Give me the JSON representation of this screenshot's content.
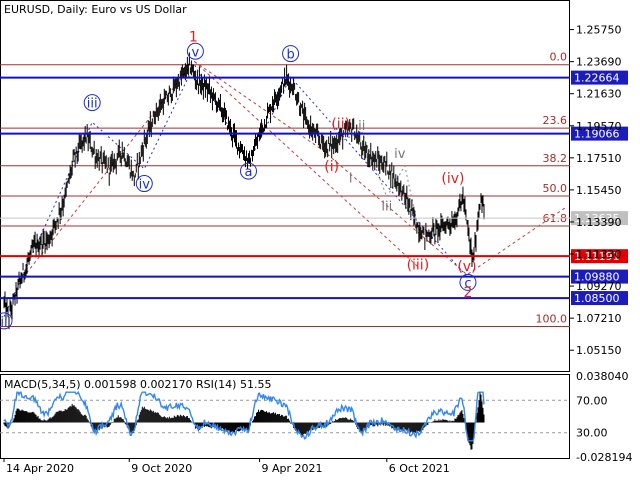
{
  "chart_data": {
    "type": "line",
    "title": "EURUSD, Daily:  Euro vs US Dollar",
    "price_axis": {
      "min": 1.0375,
      "max": 1.2765,
      "ticks": [
        "1.25750",
        "1.23690",
        "1.21630",
        "1.19570",
        "1.17510",
        "1.15450",
        "1.13390",
        "1.11330",
        "1.09270",
        "1.07210",
        "1.05150"
      ],
      "tick_values": [
        1.2575,
        1.2369,
        1.2163,
        1.1957,
        1.1751,
        1.1545,
        1.1339,
        1.1133,
        1.0927,
        1.0721,
        1.0515
      ]
    },
    "x_ticks": [
      {
        "label": "14 Apr 2020",
        "idx": 0
      },
      {
        "label": "9 Oct 2020",
        "idx": 125
      },
      {
        "label": "9 Apr 2021",
        "idx": 255
      },
      {
        "label": "6 Oct 2021",
        "idx": 382
      }
    ],
    "n_bars": 480,
    "price_anchors": [
      [
        0,
        1.082
      ],
      [
        5,
        1.073
      ],
      [
        15,
        1.094
      ],
      [
        30,
        1.118
      ],
      [
        45,
        1.123
      ],
      [
        60,
        1.148
      ],
      [
        70,
        1.175
      ],
      [
        82,
        1.189
      ],
      [
        92,
        1.176
      ],
      [
        105,
        1.168
      ],
      [
        118,
        1.18
      ],
      [
        130,
        1.162
      ],
      [
        140,
        1.185
      ],
      [
        152,
        1.205
      ],
      [
        165,
        1.215
      ],
      [
        178,
        1.228
      ],
      [
        186,
        1.234
      ],
      [
        192,
        1.225
      ],
      [
        205,
        1.218
      ],
      [
        218,
        1.205
      ],
      [
        230,
        1.188
      ],
      [
        245,
        1.172
      ],
      [
        258,
        1.195
      ],
      [
        270,
        1.213
      ],
      [
        282,
        1.226
      ],
      [
        290,
        1.219
      ],
      [
        300,
        1.2
      ],
      [
        310,
        1.19
      ],
      [
        322,
        1.182
      ],
      [
        330,
        1.184
      ],
      [
        338,
        1.19
      ],
      [
        348,
        1.195
      ],
      [
        358,
        1.18
      ],
      [
        370,
        1.174
      ],
      [
        382,
        1.17
      ],
      [
        392,
        1.16
      ],
      [
        402,
        1.148
      ],
      [
        412,
        1.132
      ],
      [
        420,
        1.125
      ],
      [
        430,
        1.128
      ],
      [
        440,
        1.132
      ],
      [
        450,
        1.135
      ],
      [
        458,
        1.15
      ],
      [
        463,
        1.128
      ],
      [
        468,
        1.108
      ],
      [
        472,
        1.13
      ],
      [
        476,
        1.152
      ],
      [
        480,
        1.134
      ]
    ],
    "levels": [
      {
        "value": 1.22664,
        "label": "1.22664",
        "kind": "blue"
      },
      {
        "value": 1.19066,
        "label": "1.19066",
        "kind": "blue"
      },
      {
        "value": 1.11191,
        "label": "1.11191",
        "kind": "red"
      },
      {
        "value": 1.0988,
        "label": "1.09880",
        "kind": "blue"
      },
      {
        "value": 1.085,
        "label": "1.08500",
        "kind": "blue"
      }
    ],
    "current_price": {
      "value": 1.13635,
      "label": "1.13635"
    },
    "fibonacci": [
      {
        "label": "0.0",
        "value": 1.2349
      },
      {
        "label": "23.6",
        "value": 1.1942
      },
      {
        "label": "38.2",
        "value": 1.17
      },
      {
        "label": "50.0",
        "value": 1.1506
      },
      {
        "label": "61.8",
        "value": 1.1313
      },
      {
        "label": "100.0",
        "value": 1.0667
      }
    ],
    "wave_labels": [
      {
        "text": "ii",
        "idx": 0,
        "price": 1.0678,
        "style": "blue",
        "circled": true
      },
      {
        "text": "iii",
        "idx": 88,
        "price": 1.208,
        "style": "blue",
        "circled": true
      },
      {
        "text": "iv",
        "idx": 140,
        "price": 1.156,
        "style": "blue",
        "circled": true
      },
      {
        "text": "1",
        "idx": 189,
        "price": 1.2505,
        "style": "red",
        "circled": false
      },
      {
        "text": "v",
        "idx": 191,
        "price": 1.241,
        "style": "blue",
        "circled": true
      },
      {
        "text": "a",
        "idx": 244,
        "price": 1.164,
        "style": "blue",
        "circled": true
      },
      {
        "text": "b",
        "idx": 286,
        "price": 1.2395,
        "style": "blue",
        "circled": true
      },
      {
        "text": "(ii)",
        "idx": 336,
        "price": 1.1945,
        "style": "red",
        "circled": false
      },
      {
        "text": "ii",
        "idx": 357,
        "price": 1.1937,
        "style": "grey",
        "circled": false
      },
      {
        "text": "iv",
        "idx": 395,
        "price": 1.1755,
        "style": "grey",
        "circled": false
      },
      {
        "text": "(i)",
        "idx": 327,
        "price": 1.1672,
        "style": "red",
        "circled": false
      },
      {
        "text": "i",
        "idx": 346,
        "price": 1.16,
        "style": "grey",
        "circled": false
      },
      {
        "text": "iii",
        "idx": 382,
        "price": 1.1418,
        "style": "grey",
        "circled": false
      },
      {
        "text": "(iv)",
        "idx": 448,
        "price": 1.1595,
        "style": "red",
        "circled": false
      },
      {
        "text": "(iii)",
        "idx": 413,
        "price": 1.104,
        "style": "red",
        "circled": false
      },
      {
        "text": "(v)",
        "idx": 462,
        "price": 1.103,
        "style": "red",
        "circled": false
      },
      {
        "text": "c",
        "idx": 463,
        "price": 1.0925,
        "style": "blue",
        "circled": true
      },
      {
        "text": "2",
        "idx": 463,
        "price": 1.0863,
        "style": "red",
        "circled": false
      }
    ],
    "indicator": {
      "title": "MACD(5,34,5) 0.001598 0.002170 RSI(14) 51.55",
      "right_ticks": [
        "0.038040",
        "70.00",
        "30.00",
        "-0.028194"
      ],
      "macd_range": [
        -0.028194,
        0.03804
      ],
      "rsi_levels": [
        70,
        30
      ]
    }
  }
}
